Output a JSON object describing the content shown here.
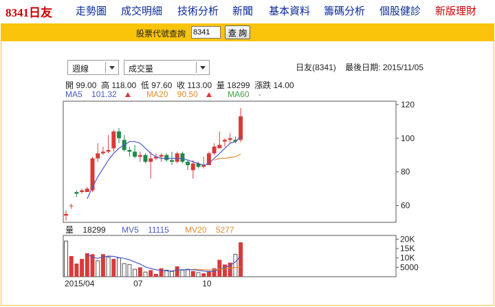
{
  "nav": {
    "title": "8341日友",
    "items": [
      {
        "label": "走勢圖"
      },
      {
        "label": "成交明細"
      },
      {
        "label": "技術分析"
      },
      {
        "label": "新聞"
      },
      {
        "label": "基本資料"
      },
      {
        "label": "籌碼分析"
      },
      {
        "label": "個股健診"
      },
      {
        "label": "新版理財"
      }
    ]
  },
  "query": {
    "label": "股票代號查詢",
    "value": "8341",
    "button": "查 詢"
  },
  "controls": {
    "period": "週線",
    "indicator": "成交量"
  },
  "info": {
    "stock": "日友(8341)",
    "date_label": "最後日期:",
    "date": "2015/11/05"
  },
  "ohlc": {
    "open_label": "開",
    "open": "99.00",
    "high_label": "高",
    "high": "118.00",
    "low_label": "低",
    "low": "97.60",
    "close_label": "收",
    "close": "113.00",
    "volume_label": "量",
    "volume": "18299",
    "change_label": "漲跌",
    "change": "14.00"
  },
  "ma": {
    "ma5_label": "MA5",
    "ma5": "101.32",
    "ma20_label": "MA20",
    "ma20": "90.50",
    "ma60_label": "MA60",
    "ma60": "-"
  },
  "vol_info": {
    "vol_label": "量",
    "vol": "18299",
    "mv5_label": "MV5",
    "mv5": "11115",
    "mv20_label": "MV20",
    "mv20": "5277"
  },
  "colors": {
    "up": "#d83a3a",
    "down": "#1f8a4a",
    "ma5": "#4658c8",
    "ma20": "#e08a2a",
    "ma60": "#3aa04a",
    "nav_link": "#0a2a9a",
    "query_bar": "#f9c40a"
  },
  "chart_data": [
    {
      "type": "candlestick",
      "title": "",
      "ylim": [
        50,
        122
      ],
      "y_ticks": [
        60,
        80,
        100,
        120
      ],
      "x_ticks": [
        {
          "index": 0,
          "label": "2015/04"
        },
        {
          "index": 13,
          "label": "07"
        },
        {
          "index": 26,
          "label": "10"
        }
      ],
      "grid": false,
      "candles": [
        {
          "o": 54,
          "h": 57,
          "l": 51,
          "c": 55
        },
        {
          "o": 60,
          "h": 61,
          "l": 58,
          "c": 60
        },
        {
          "o": 68,
          "h": 69,
          "l": 65,
          "c": 67
        },
        {
          "o": 68,
          "h": 70,
          "l": 67,
          "c": 69
        },
        {
          "o": 68,
          "h": 71,
          "l": 68,
          "c": 70
        },
        {
          "o": 69,
          "h": 89,
          "l": 68,
          "c": 88
        },
        {
          "o": 88,
          "h": 97,
          "l": 86,
          "c": 91
        },
        {
          "o": 91,
          "h": 95,
          "l": 90,
          "c": 92
        },
        {
          "o": 92,
          "h": 102,
          "l": 91,
          "c": 93
        },
        {
          "o": 94,
          "h": 105,
          "l": 92,
          "c": 104
        },
        {
          "o": 104,
          "h": 106,
          "l": 97,
          "c": 100
        },
        {
          "o": 99,
          "h": 102,
          "l": 92,
          "c": 93
        },
        {
          "o": 93,
          "h": 95,
          "l": 89,
          "c": 92
        },
        {
          "o": 92,
          "h": 96,
          "l": 88,
          "c": 89
        },
        {
          "o": 89,
          "h": 92,
          "l": 86,
          "c": 90
        },
        {
          "o": 90,
          "h": 91,
          "l": 85,
          "c": 86
        },
        {
          "o": 86,
          "h": 92,
          "l": 76,
          "c": 88
        },
        {
          "o": 88,
          "h": 91,
          "l": 87,
          "c": 89
        },
        {
          "o": 89,
          "h": 91,
          "l": 86,
          "c": 90
        },
        {
          "o": 90,
          "h": 91,
          "l": 86,
          "c": 87
        },
        {
          "o": 87,
          "h": 92,
          "l": 84,
          "c": 86
        },
        {
          "o": 86,
          "h": 92,
          "l": 85,
          "c": 91
        },
        {
          "o": 91,
          "h": 92,
          "l": 85,
          "c": 86
        },
        {
          "o": 86,
          "h": 87,
          "l": 81,
          "c": 84
        },
        {
          "o": 81,
          "h": 87,
          "l": 76,
          "c": 85
        },
        {
          "o": 85,
          "h": 86,
          "l": 82,
          "c": 83
        },
        {
          "o": 83,
          "h": 89,
          "l": 82,
          "c": 84
        },
        {
          "o": 84,
          "h": 92,
          "l": 84,
          "c": 91
        },
        {
          "o": 91,
          "h": 97,
          "l": 90,
          "c": 95
        },
        {
          "o": 94,
          "h": 104,
          "l": 94,
          "c": 96
        },
        {
          "o": 98,
          "h": 100,
          "l": 95,
          "c": 99
        },
        {
          "o": 99,
          "h": 103,
          "l": 97,
          "c": 100
        },
        {
          "o": 99,
          "h": 101,
          "l": 97,
          "c": 98
        },
        {
          "o": 99,
          "h": 118,
          "l": 97.6,
          "c": 113
        }
      ],
      "ma5": [
        null,
        null,
        null,
        null,
        64,
        71,
        77,
        82,
        87,
        91,
        94,
        96,
        98,
        98,
        97,
        94,
        91,
        89,
        88,
        88,
        88,
        88,
        88,
        87,
        86,
        85,
        84,
        85,
        88,
        91,
        94,
        97,
        98,
        101
      ],
      "ma20": [
        null,
        null,
        null,
        null,
        null,
        null,
        null,
        null,
        null,
        null,
        null,
        null,
        null,
        null,
        null,
        null,
        null,
        null,
        null,
        null,
        null,
        null,
        null,
        null,
        null,
        null,
        null,
        null,
        87,
        88,
        88,
        88.5,
        89,
        90.5
      ]
    },
    {
      "type": "bar",
      "title": "",
      "ylim": [
        0,
        22000
      ],
      "y_ticks": [
        {
          "value": 5000,
          "label": "5000"
        },
        {
          "value": 10000,
          "label": "10K"
        },
        {
          "value": 15000,
          "label": "15K"
        },
        {
          "value": 20000,
          "label": "20K"
        }
      ],
      "values": [
        19000,
        11000,
        7000,
        9500,
        12500,
        12000,
        8500,
        12000,
        10500,
        9500,
        10000,
        7000,
        6500,
        4000,
        5000,
        2500,
        3500,
        1500,
        4500,
        3500,
        2800,
        5500,
        3500,
        4000,
        3000,
        2200,
        1800,
        3000,
        4500,
        9000,
        6500,
        7500,
        12000,
        18299
      ],
      "up_flags": [
        false,
        true,
        true,
        true,
        true,
        true,
        false,
        true,
        false,
        true,
        false,
        false,
        false,
        false,
        true,
        false,
        true,
        true,
        true,
        false,
        false,
        true,
        false,
        false,
        true,
        false,
        true,
        true,
        true,
        true,
        true,
        true,
        false,
        true
      ],
      "mv5": [
        null,
        null,
        null,
        null,
        11800,
        10500,
        9800,
        10500,
        11000,
        10800,
        10200,
        9800,
        9000,
        7800,
        6800,
        5200,
        4400,
        3700,
        3400,
        3100,
        3000,
        3600,
        3700,
        3700,
        3800,
        3400,
        3000,
        2800,
        2900,
        4100,
        4800,
        6100,
        7900,
        11115
      ],
      "mv20": [
        null,
        null,
        null,
        null,
        null,
        null,
        null,
        null,
        null,
        null,
        null,
        null,
        null,
        null,
        null,
        null,
        null,
        null,
        null,
        null,
        null,
        null,
        null,
        null,
        4100,
        3800,
        3700,
        3600,
        3700,
        4000,
        4300,
        4600,
        4900,
        5277
      ]
    }
  ]
}
